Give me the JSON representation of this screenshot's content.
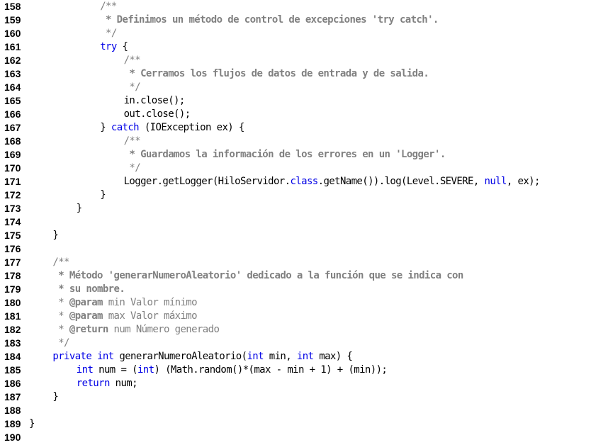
{
  "editor": {
    "lines": [
      {
        "n": "158",
        "indent": 6,
        "spans": [
          {
            "c": "cm",
            "t": "/**"
          }
        ]
      },
      {
        "n": "159",
        "indent": 6,
        "spans": [
          {
            "c": "cmb",
            "t": " * Definimos un método de control de excepciones 'try catch'."
          }
        ]
      },
      {
        "n": "160",
        "indent": 6,
        "spans": [
          {
            "c": "cm",
            "t": " */"
          }
        ]
      },
      {
        "n": "161",
        "indent": 6,
        "spans": [
          {
            "c": "kw",
            "t": "try"
          },
          {
            "c": "",
            "t": " {"
          }
        ]
      },
      {
        "n": "162",
        "indent": 8,
        "spans": [
          {
            "c": "cm",
            "t": "/**"
          }
        ]
      },
      {
        "n": "163",
        "indent": 8,
        "spans": [
          {
            "c": "cmb",
            "t": " * Cerramos los flujos de datos de entrada y de salida."
          }
        ]
      },
      {
        "n": "164",
        "indent": 8,
        "spans": [
          {
            "c": "cm",
            "t": " */"
          }
        ]
      },
      {
        "n": "165",
        "indent": 8,
        "spans": [
          {
            "c": "",
            "t": "in.close();"
          }
        ]
      },
      {
        "n": "166",
        "indent": 8,
        "spans": [
          {
            "c": "",
            "t": "out.close();"
          }
        ]
      },
      {
        "n": "167",
        "indent": 6,
        "spans": [
          {
            "c": "",
            "t": "} "
          },
          {
            "c": "kw",
            "t": "catch"
          },
          {
            "c": "",
            "t": " (IOException ex) {"
          }
        ]
      },
      {
        "n": "168",
        "indent": 8,
        "spans": [
          {
            "c": "cm",
            "t": "/**"
          }
        ]
      },
      {
        "n": "169",
        "indent": 8,
        "spans": [
          {
            "c": "cmb",
            "t": " * Guardamos la información de los errores en un 'Logger'."
          }
        ]
      },
      {
        "n": "170",
        "indent": 8,
        "spans": [
          {
            "c": "cm",
            "t": " */"
          }
        ]
      },
      {
        "n": "171",
        "indent": 8,
        "spans": [
          {
            "c": "",
            "t": "Logger.getLogger(HiloServidor."
          },
          {
            "c": "kw",
            "t": "class"
          },
          {
            "c": "",
            "t": ".getName()).log(Level.SEVERE, "
          },
          {
            "c": "kw",
            "t": "null"
          },
          {
            "c": "",
            "t": ", ex);"
          }
        ]
      },
      {
        "n": "172",
        "indent": 6,
        "spans": [
          {
            "c": "",
            "t": "}"
          }
        ]
      },
      {
        "n": "173",
        "indent": 4,
        "spans": [
          {
            "c": "",
            "t": "}"
          }
        ]
      },
      {
        "n": "174",
        "indent": 0,
        "spans": []
      },
      {
        "n": "175",
        "indent": 2,
        "spans": [
          {
            "c": "",
            "t": "}"
          }
        ]
      },
      {
        "n": "176",
        "indent": 0,
        "spans": []
      },
      {
        "n": "177",
        "indent": 2,
        "spans": [
          {
            "c": "cm",
            "t": "/**"
          }
        ]
      },
      {
        "n": "178",
        "indent": 2,
        "spans": [
          {
            "c": "cmb",
            "t": " * Método 'generarNumeroAleatorio' dedicado a la función que se indica con"
          }
        ]
      },
      {
        "n": "179",
        "indent": 2,
        "spans": [
          {
            "c": "cmb",
            "t": " * su nombre."
          }
        ]
      },
      {
        "n": "180",
        "indent": 2,
        "spans": [
          {
            "c": "cm",
            "t": " * "
          },
          {
            "c": "tag",
            "t": "@param"
          },
          {
            "c": "cm",
            "t": " min Valor mínimo"
          }
        ]
      },
      {
        "n": "181",
        "indent": 2,
        "spans": [
          {
            "c": "cm",
            "t": " * "
          },
          {
            "c": "tag",
            "t": "@param"
          },
          {
            "c": "cm",
            "t": " max Valor máximo"
          }
        ]
      },
      {
        "n": "182",
        "indent": 2,
        "spans": [
          {
            "c": "cm",
            "t": " * "
          },
          {
            "c": "tag",
            "t": "@return"
          },
          {
            "c": "cm",
            "t": " num Número generado"
          }
        ]
      },
      {
        "n": "183",
        "indent": 2,
        "spans": [
          {
            "c": "cm",
            "t": " */"
          }
        ]
      },
      {
        "n": "184",
        "indent": 2,
        "spans": [
          {
            "c": "kw",
            "t": "private"
          },
          {
            "c": "",
            "t": " "
          },
          {
            "c": "kw",
            "t": "int"
          },
          {
            "c": "",
            "t": " generarNumeroAleatorio("
          },
          {
            "c": "kw",
            "t": "int"
          },
          {
            "c": "",
            "t": " min, "
          },
          {
            "c": "kw",
            "t": "int"
          },
          {
            "c": "",
            "t": " max) {"
          }
        ]
      },
      {
        "n": "185",
        "indent": 4,
        "spans": [
          {
            "c": "kw",
            "t": "int"
          },
          {
            "c": "",
            "t": " num = ("
          },
          {
            "c": "kw",
            "t": "int"
          },
          {
            "c": "",
            "t": ") (Math.random()*(max - min + 1) + (min));"
          }
        ]
      },
      {
        "n": "186",
        "indent": 4,
        "spans": [
          {
            "c": "kw",
            "t": "return"
          },
          {
            "c": "",
            "t": " num;"
          }
        ]
      },
      {
        "n": "187",
        "indent": 2,
        "spans": [
          {
            "c": "",
            "t": "}"
          }
        ]
      },
      {
        "n": "188",
        "indent": 0,
        "spans": []
      },
      {
        "n": "189",
        "indent": 0,
        "spans": [
          {
            "c": "",
            "t": "}"
          }
        ]
      },
      {
        "n": "190",
        "indent": 0,
        "spans": []
      }
    ]
  }
}
